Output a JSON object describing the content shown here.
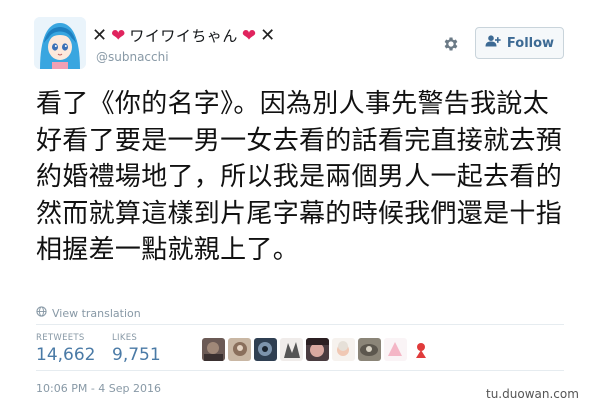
{
  "user": {
    "display_name": "ワイワイちゃん",
    "handle": "@subnacchi"
  },
  "follow_button": {
    "label": "Follow"
  },
  "tweet": {
    "lines": [
      "看了《你的名字》。因為別人事先警告我說太",
      "好看了要是一男一女去看的話看完直接就去預",
      "約婚禮場地了，所以我是兩個男人一起去看的",
      "然而就算這樣到片尾字幕的時候我們還是十指",
      "相握差一點就親上了。"
    ]
  },
  "translate": {
    "label": "View translation"
  },
  "stats": {
    "retweets_label": "RETWEETS",
    "retweets_value": "14,662",
    "likes_label": "LIKES",
    "likes_value": "9,751"
  },
  "timestamp": "10:06 PM - 4 Sep 2016",
  "watermark": "tu.duowan.com",
  "colors": {
    "heart": "#e0245e",
    "link": "#4a7aa6",
    "muted": "#8899a6"
  },
  "icons": {
    "gear": "gear-icon",
    "follow": "add-user-icon",
    "translate": "globe-icon"
  }
}
